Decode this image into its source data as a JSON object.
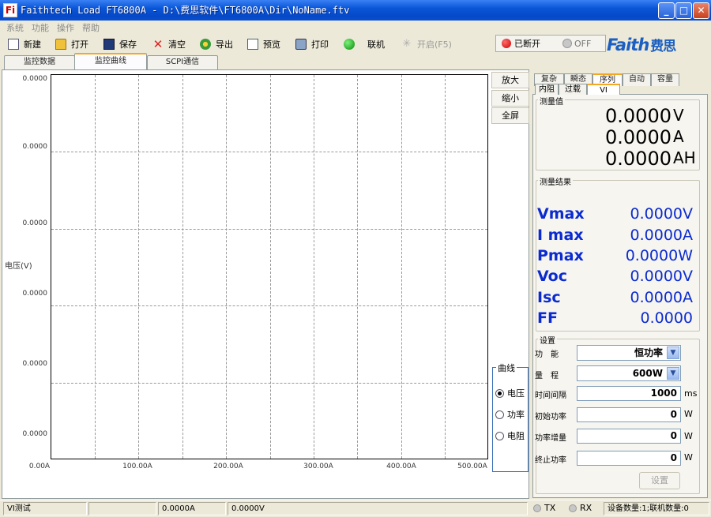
{
  "window": {
    "title": "Faithtech Load FT6800A - D:\\费思软件\\FT6800A\\Dir\\NoName.ftv",
    "min": "_",
    "max": "□",
    "close": "✕"
  },
  "menu": [
    "系统",
    "功能",
    "操作",
    "帮助"
  ],
  "toolbar": {
    "new": "新建",
    "open": "打开",
    "save": "保存",
    "clear": "清空",
    "export": "导出",
    "preview": "预览",
    "print": "打印",
    "connect": "联机",
    "start": "开启(F5)",
    "status_disconnected": "已断开",
    "status_off": "OFF"
  },
  "brand": {
    "name": "Faith",
    "cn": "费思",
    "color": "#1b5fc2"
  },
  "tabs": [
    "监控数据",
    "监控曲线",
    "SCPI通信"
  ],
  "plot": {
    "y_ticks": [
      "0.0000",
      "0.0000",
      "0.0000",
      "0.0000",
      "0.0000",
      "0.0000"
    ],
    "x_ticks": [
      "0.00A",
      "100.00A",
      "200.00A",
      "300.00A",
      "400.00A",
      "500.00A"
    ],
    "ylabel": "电压(V)"
  },
  "zoom": {
    "zoom_in": "放大",
    "zoom_out": "缩小",
    "fullscreen": "全屏"
  },
  "curve": {
    "title": "曲线",
    "options": [
      "电压",
      "功率",
      "电阻"
    ],
    "selected": 0
  },
  "right_tabs": [
    "复杂",
    "瞬态",
    "序列",
    "自动",
    "容量"
  ],
  "sub_tabs": [
    "内阻",
    "过载",
    "VI"
  ],
  "measure": {
    "title": "测量值",
    "v": "0.0000",
    "v_unit": "V",
    "a": "0.0000",
    "a_unit": "A",
    "ah": "0.0000",
    "ah_unit": "AH"
  },
  "results": {
    "title": "测量结果",
    "rows": [
      {
        "label": "Vmax",
        "value": "0.0000",
        "unit": "V"
      },
      {
        "label": "I max",
        "value": "0.0000",
        "unit": "A"
      },
      {
        "label": "Pmax",
        "value": "0.0000",
        "unit": "W"
      },
      {
        "label": "Voc",
        "value": "0.0000",
        "unit": "V"
      },
      {
        "label": "Isc",
        "value": "0.0000",
        "unit": "A"
      },
      {
        "label": "FF",
        "value": "0.0000",
        "unit": ""
      }
    ]
  },
  "settings": {
    "title": "设置",
    "function_label": "功　能",
    "function_value": "恒功率",
    "range_label": "量　程",
    "range_value": "600W",
    "interval_label": "时间间隔",
    "interval_value": "1000",
    "interval_unit": "ms",
    "start_label": "初始功率",
    "start_value": "0",
    "start_unit": "W",
    "step_label": "功率增量",
    "step_value": "0",
    "step_unit": "W",
    "end_label": "终止功率",
    "end_value": "0",
    "end_unit": "W",
    "apply": "设置"
  },
  "statusbar": {
    "mode": "VI测试",
    "current": "0.0000A",
    "voltage": "0.0000V",
    "tx": "TX",
    "rx": "RX",
    "devices": "设备数量:1;联机数量:0"
  }
}
